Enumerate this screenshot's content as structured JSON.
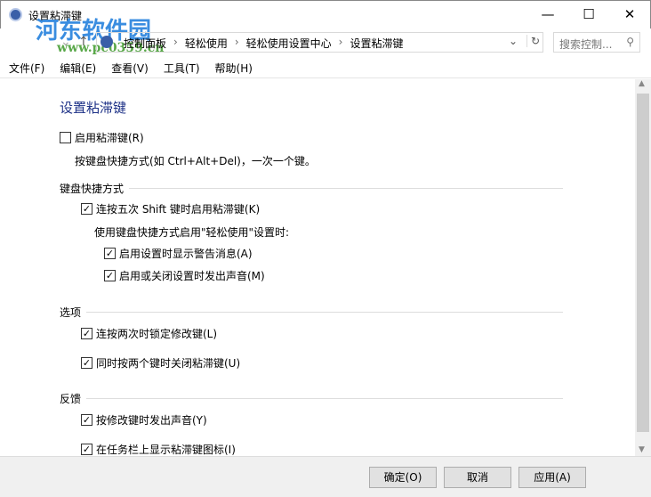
{
  "window": {
    "title": "设置粘滞键"
  },
  "watermark": {
    "name": "河东软件园",
    "url": "www.pc0359.cn"
  },
  "address": {
    "crumbs": [
      "控制面板",
      "轻松使用",
      "轻松使用设置中心",
      "设置粘滞键"
    ],
    "search_placeholder": "搜索控制...",
    "sep": "›"
  },
  "menu": [
    "文件(F)",
    "编辑(E)",
    "查看(V)",
    "工具(T)",
    "帮助(H)"
  ],
  "main": {
    "heading": "设置粘滞键",
    "enable": {
      "label": "启用粘滞键(R)",
      "checked": false
    },
    "enable_desc": "按键盘快捷方式(如 Ctrl+Alt+Del)，一次一个键。",
    "sections": {
      "shortcut": "键盘快捷方式",
      "options": "选项",
      "feedback": "反馈"
    },
    "shift5": {
      "label": "连按五次 Shift 键时启用粘滞键(K)",
      "checked": true
    },
    "shortcut_desc": "使用键盘快捷方式启用\"轻松使用\"设置时:",
    "warn": {
      "label": "启用设置时显示警告消息(A)",
      "checked": true
    },
    "sound": {
      "label": "启用或关闭设置时发出声音(M)",
      "checked": true
    },
    "lock": {
      "label": "连按两次时锁定修改键(L)",
      "checked": true
    },
    "twokeys": {
      "label": "同时按两个键时关闭粘滞键(U)",
      "checked": true
    },
    "beep": {
      "label": "按修改键时发出声音(Y)",
      "checked": true
    },
    "taskbar": {
      "label": "在任务栏上显示粘滞键图标(I)",
      "checked": true
    }
  },
  "footer": {
    "ok": "确定(O)",
    "cancel": "取消",
    "apply": "应用(A)"
  },
  "check": "✓"
}
